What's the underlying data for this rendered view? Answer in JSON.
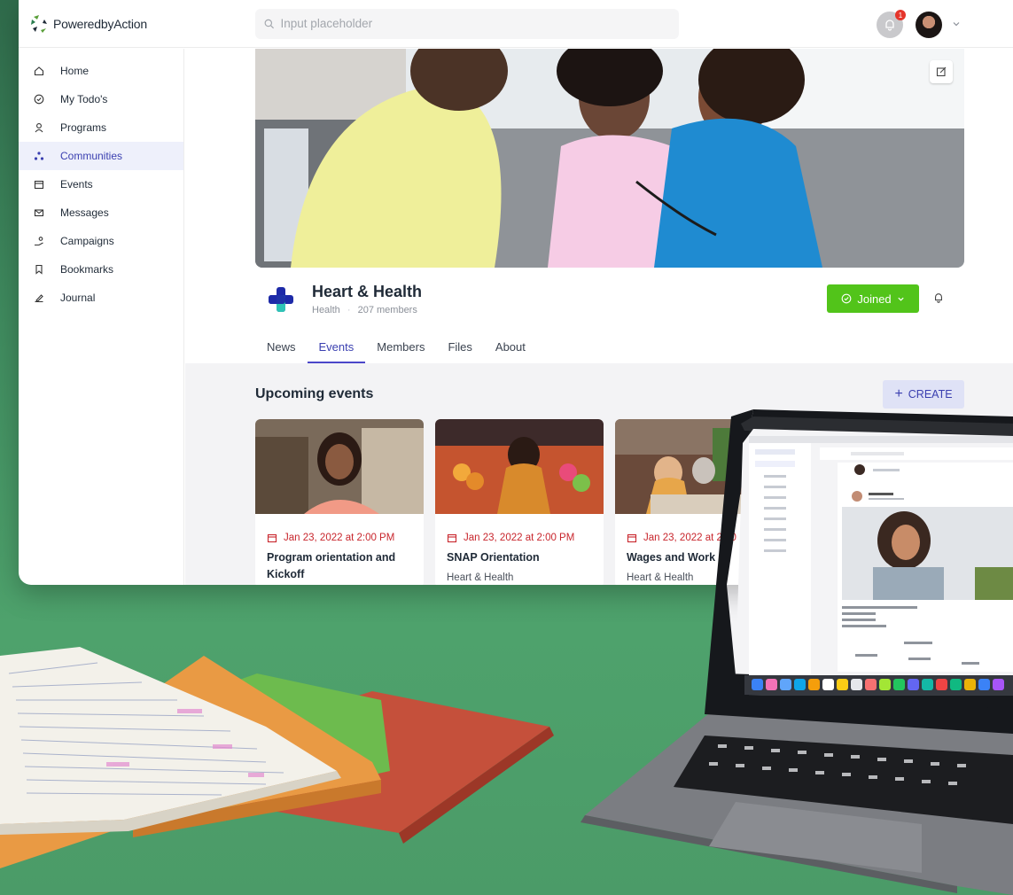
{
  "brand": {
    "name": "PoweredbyAction"
  },
  "search": {
    "placeholder": "Input placeholder"
  },
  "notifications": {
    "count": "1"
  },
  "sidebar": {
    "items": [
      {
        "label": "Home",
        "icon": "home-icon"
      },
      {
        "label": "My Todo's",
        "icon": "check-circle-icon"
      },
      {
        "label": "Programs",
        "icon": "programs-icon"
      },
      {
        "label": "Communities",
        "icon": "communities-icon",
        "active": true
      },
      {
        "label": "Events",
        "icon": "calendar-icon"
      },
      {
        "label": "Messages",
        "icon": "mail-icon"
      },
      {
        "label": "Campaigns",
        "icon": "campaigns-icon"
      },
      {
        "label": "Bookmarks",
        "icon": "bookmark-icon"
      },
      {
        "label": "Journal",
        "icon": "journal-icon"
      }
    ]
  },
  "community": {
    "title": "Heart & Health",
    "category": "Health",
    "members": "207 members",
    "joined_label": "Joined"
  },
  "tabs": [
    "News",
    "Events",
    "Members",
    "Files",
    "About"
  ],
  "active_tab": "Events",
  "events": {
    "title": "Upcoming events",
    "create_label": "CREATE",
    "items": [
      {
        "date": "Jan 23, 2022 at 2:00 PM",
        "title": "Program orientation and Kickoff",
        "subtitle": ""
      },
      {
        "date": "Jan 23, 2022 at 2:00 PM",
        "title": "SNAP Orientation",
        "subtitle": "Heart & Health"
      },
      {
        "date": "Jan 23, 2022 at 2:00",
        "title": "Wages and Work",
        "subtitle": "Heart & Health"
      }
    ]
  },
  "colors": {
    "accent": "#3a3fb0",
    "joined": "#52c41a",
    "date": "#c8252c",
    "background": "#3f8a5e"
  }
}
